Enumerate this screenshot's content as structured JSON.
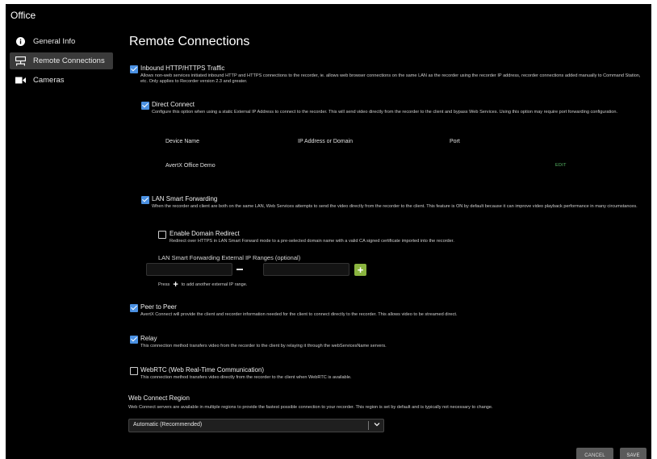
{
  "app": {
    "title": "Office"
  },
  "sidebar": {
    "items": [
      {
        "label": "General Info",
        "icon": "info-icon",
        "active": false
      },
      {
        "label": "Remote Connections",
        "icon": "network-icon",
        "active": true
      },
      {
        "label": "Cameras",
        "icon": "camera-icon",
        "active": false
      }
    ]
  },
  "main": {
    "title": "Remote Connections",
    "inbound": {
      "checked": true,
      "title": "Inbound HTTP/HTTPS Traffic",
      "desc": "Allows non-web services initiated inbound HTTP and HTTPS connections to the recorder, ie. allows web browser connections on the same LAN as the recorder using the recorder IP address, recorder connections added manually to Command Station, etc. Only applies to Recorder version 2.3 and greater."
    },
    "direct": {
      "checked": true,
      "title": "Direct Connect",
      "desc": "Configure this option when using a static External IP Address to connect to the recorder. This will send video directly from the recorder to the client and bypass Web Services. Using this option may require port forwarding configuration.",
      "columns": [
        "Device Name",
        "IP Address or Domain",
        "Port"
      ],
      "rows": [
        {
          "device": "AvertX Office Demo",
          "ip": "",
          "port": "",
          "action": "EDIT"
        }
      ]
    },
    "lan": {
      "checked": true,
      "title": "LAN Smart Forwarding",
      "desc": "When the recorder and client are both on the same LAN, Web Services attempts to send the video directly from the recorder to the client. This feature is ON by default because it can improve video playback performance in many circumstances.",
      "domain_redirect": {
        "checked": false,
        "title": "Enable Domain Redirect",
        "desc": "Redirect over HTTPS in LAN Smart Forward mode to a pre-selected domain name with a valid CA signed certificate imported into the recorder."
      },
      "ranges_label": "LAN Smart Forwarding External IP Ranges (optional)",
      "range_start": "",
      "range_end": "",
      "hint_pre": "Press",
      "hint_post": "to add another external IP range."
    },
    "p2p": {
      "checked": true,
      "title": "Peer to Peer",
      "desc": "AvertX Connect will provide the client and recorder information needed for the client to connect directly to the recorder. This allows video to be streamed direct."
    },
    "relay": {
      "checked": true,
      "title": "Relay",
      "desc": "This connection method transfers video from the recorder to the client by relaying it through the webServicesName servers."
    },
    "webrtc": {
      "checked": false,
      "title": "WebRTC (Web Real-Time Communication)",
      "desc": "This connection method transfers video directly from the recorder to the client when WebRTC is available."
    },
    "region": {
      "title": "Web Connect Region",
      "desc": "Web Connect servers are available in multiple regions to provide the fastest possible connection to your recorder. This region is set by default and is typically not necessary to change.",
      "selected": "Automatic (Recommended)"
    }
  },
  "footer": {
    "cancel": "CANCEL",
    "save": "SAVE"
  },
  "colors": {
    "accent": "#4a90e2",
    "add_button": "#8ab43f",
    "edit_link": "#5bbf6a",
    "background": "#000000"
  }
}
